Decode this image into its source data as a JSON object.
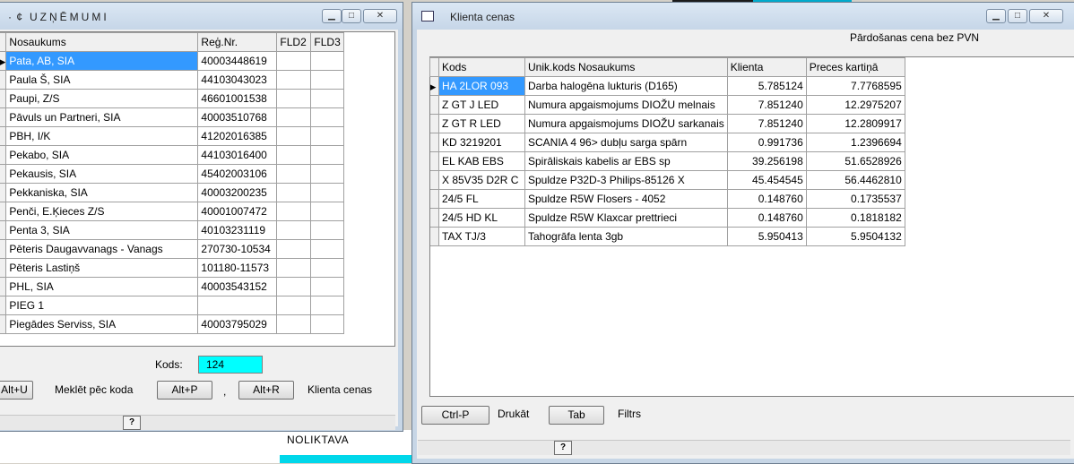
{
  "desktop": {
    "noliktava_label": "NOLIKTAVA"
  },
  "left_window": {
    "title": "UZŅĒMUMI",
    "title_prefix": "· ¢",
    "columns": [
      "Nosaukums",
      "Reģ.Nr.",
      "FLD2",
      "FLD3"
    ],
    "rows": [
      {
        "name": "Pata, AB, SIA",
        "reg": "40003448619",
        "fld2": "",
        "fld3": ""
      },
      {
        "name": "Paula Š, SIA",
        "reg": "44103043023",
        "fld2": "",
        "fld3": ""
      },
      {
        "name": "Paupi, Z/S",
        "reg": "46601001538",
        "fld2": "",
        "fld3": ""
      },
      {
        "name": "Pāvuls un Partneri, SIA",
        "reg": "40003510768",
        "fld2": "",
        "fld3": ""
      },
      {
        "name": "PBH, I/K",
        "reg": "41202016385",
        "fld2": "",
        "fld3": ""
      },
      {
        "name": "Pekabo, SIA",
        "reg": "44103016400",
        "fld2": "",
        "fld3": ""
      },
      {
        "name": "Pekausis, SIA",
        "reg": "45402003106",
        "fld2": "",
        "fld3": ""
      },
      {
        "name": "Pekkaniska, SIA",
        "reg": "40003200235",
        "fld2": "",
        "fld3": ""
      },
      {
        "name": "Penči, E.Ķieces Z/S",
        "reg": "40001007472",
        "fld2": "",
        "fld3": ""
      },
      {
        "name": "Penta 3, SIA",
        "reg": "40103231119",
        "fld2": "",
        "fld3": ""
      },
      {
        "name": "Pēteris Daugavvanags - Vanags",
        "reg": "270730-10534",
        "fld2": "",
        "fld3": ""
      },
      {
        "name": "Pēteris Lastiņš",
        "reg": "101180-11573",
        "fld2": "",
        "fld3": ""
      },
      {
        "name": "PHL, SIA",
        "reg": "40003543152",
        "fld2": "",
        "fld3": ""
      },
      {
        "name": "PIEG 1",
        "reg": "",
        "fld2": "",
        "fld3": ""
      },
      {
        "name": "Piegādes Serviss, SIA",
        "reg": "40003795029",
        "fld2": "",
        "fld3": ""
      }
    ],
    "selected_row": 0,
    "kods_label": "Kods:",
    "kods_value": "124",
    "btn_alt_u": "Alt+U",
    "search_by_code_label": "Meklēt pēc koda",
    "btn_alt_p": "Alt+P",
    "comma": ",",
    "btn_alt_r": "Alt+R",
    "client_prices_label": "Klienta cenas",
    "help_btn": "?"
  },
  "right_window": {
    "title": "Klienta cenas",
    "header_caption": "Pārdošanas cena bez PVN",
    "columns": [
      "Kods",
      "Unik.kods  Nosaukums",
      "Klienta",
      "Preces kartiņā"
    ],
    "rows": [
      {
        "kods": "HA 2LOR 093",
        "name": "Darba halogēna lukturis (D165)",
        "klienta": "5.785124",
        "preces": "7.7768595"
      },
      {
        "kods": "Z GT J LED",
        "name": "Numura apgaismojums DIOŽU melnais",
        "klienta": "7.851240",
        "preces": "12.2975207"
      },
      {
        "kods": "Z GT R LED",
        "name": "Numura apgaismojums DIOŽU sarkanais",
        "klienta": "7.851240",
        "preces": "12.2809917"
      },
      {
        "kods": "KD 3219201",
        "name": "SCANIA 4 96> dubļu sarga spārn",
        "klienta": "0.991736",
        "preces": "1.2396694"
      },
      {
        "kods": "EL KAB EBS",
        "name": "Spirāliskais kabelis ar EBS sp",
        "klienta": "39.256198",
        "preces": "51.6528926"
      },
      {
        "kods": "X 85V35 D2R C",
        "name": "Spuldze P32D-3 Philips-85126 X",
        "klienta": "45.454545",
        "preces": "56.4462810"
      },
      {
        "kods": "24/5 FL",
        "name": "Spuldze R5W Flosers - 4052",
        "klienta": "0.148760",
        "preces": "0.1735537"
      },
      {
        "kods": "24/5 HD KL",
        "name": "Spuldze R5W Klaxcar prettrieci",
        "klienta": "0.148760",
        "preces": "0.1818182"
      },
      {
        "kods": "TAX TJ/3",
        "name": "Tahogrāfa lenta 3gb",
        "klienta": "5.950413",
        "preces": "5.9504132"
      }
    ],
    "selected_row": 0,
    "btn_ctrl_p": "Ctrl-P",
    "print_label": "Drukāt",
    "btn_tab": "Tab",
    "filter_label": "Filtrs",
    "help_btn": "?"
  }
}
